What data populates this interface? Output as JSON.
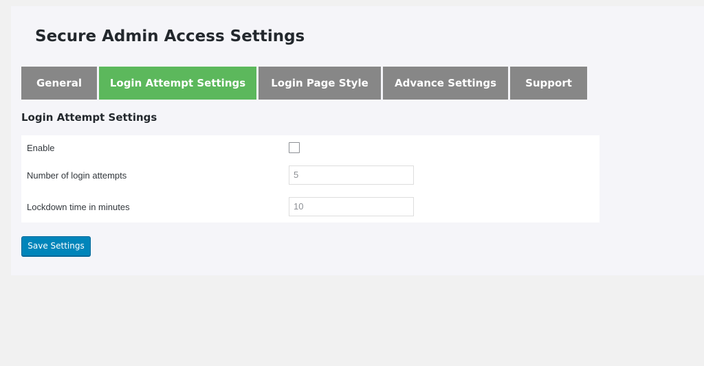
{
  "page": {
    "title": "Secure Admin Access Settings"
  },
  "tabs": [
    {
      "label": "General",
      "active": false
    },
    {
      "label": "Login Attempt Settings",
      "active": true
    },
    {
      "label": "Login Page Style",
      "active": false
    },
    {
      "label": "Advance Settings",
      "active": false
    },
    {
      "label": "Support",
      "active": false
    }
  ],
  "section": {
    "heading": "Login Attempt Settings"
  },
  "form": {
    "enable_label": "Enable",
    "enable_checked": false,
    "attempts_label": "Number of login attempts",
    "attempts_placeholder": "5",
    "lockdown_label": "Lockdown time in minutes",
    "lockdown_placeholder": "10"
  },
  "actions": {
    "save_label": "Save Settings"
  },
  "colors": {
    "tab_inactive": "#878787",
    "tab_active": "#5cb85c",
    "primary_button": "#0085ba"
  }
}
